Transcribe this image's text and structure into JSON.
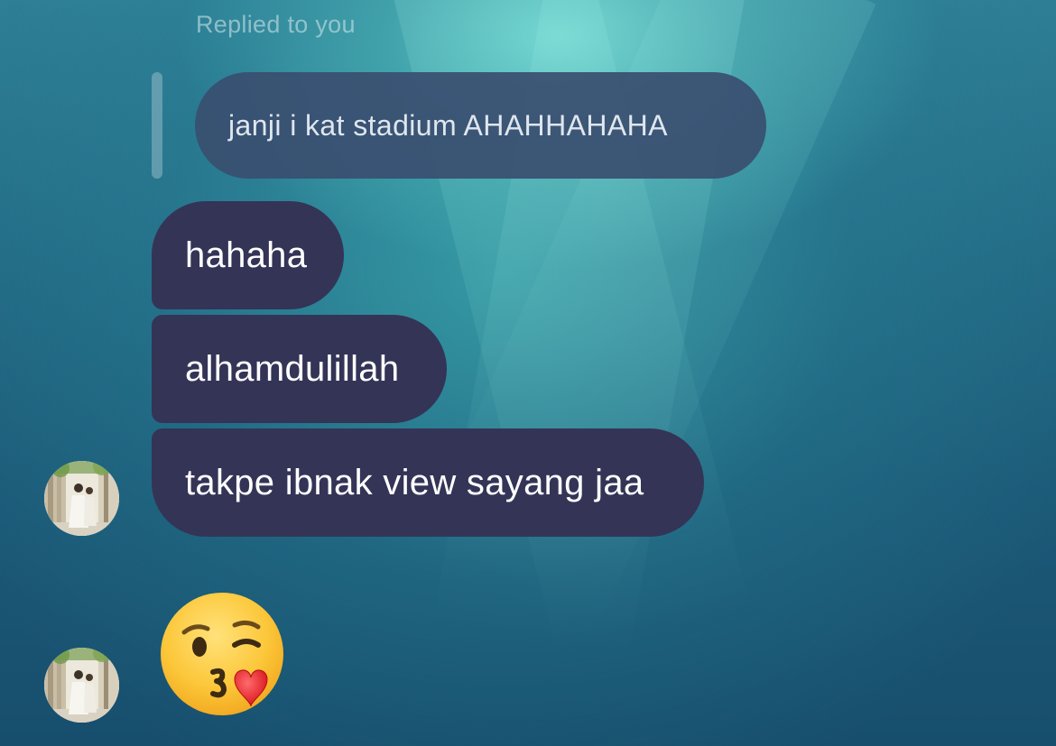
{
  "thread": {
    "replied_label": "Replied to you",
    "quoted_message": "janji i kat stadium AHAHHAHAHA",
    "messages": [
      {
        "text": "hahaha"
      },
      {
        "text": "alhamdulillah"
      },
      {
        "text": "takpe ibnak view sayang jaa"
      }
    ],
    "emoji_message": "face-blowing-a-kiss-emoji"
  },
  "colors": {
    "bubble": "#343457",
    "reply_bubble": "#3a4e70",
    "background_top": "#2e7f96",
    "background_bottom": "#174e6d"
  },
  "icons": {
    "avatar": "profile-photo-avatar",
    "emoji": "face-blowing-a-kiss"
  }
}
